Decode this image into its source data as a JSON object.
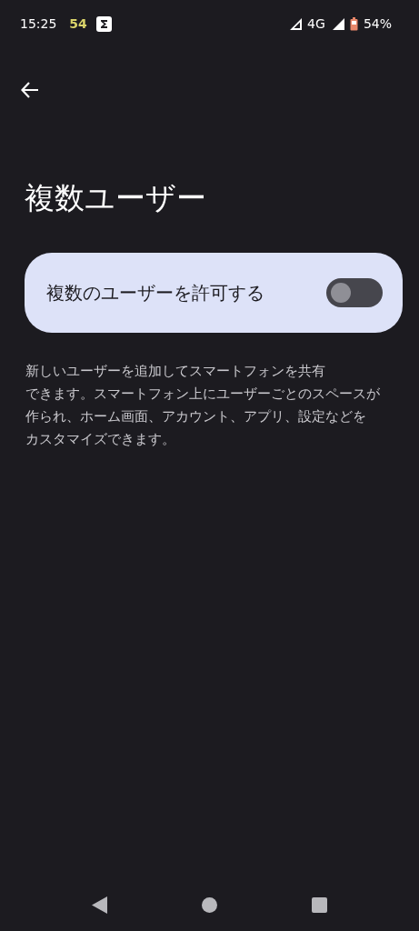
{
  "status_bar": {
    "time": "15:25",
    "badge": "54",
    "network": "4G",
    "battery": "54%"
  },
  "title": "複数ユーザー",
  "toggle": {
    "label": "複数のユーザーを許可する",
    "on": false
  },
  "description": [
    "新しいユーザーを追加してスマートフォンを共有",
    "できます。スマートフォン上にユーザーごとのスペースが",
    "作られ、ホーム画面、アカウント、アプリ、設定などを",
    "カスタマイズできます。"
  ]
}
